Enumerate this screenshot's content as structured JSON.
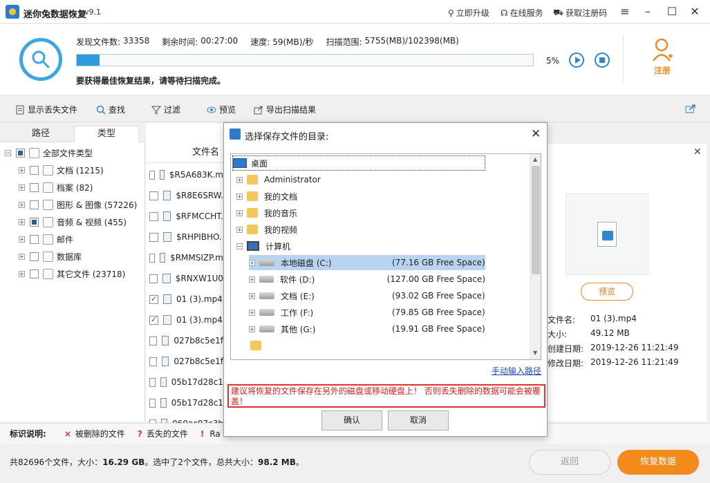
{
  "app": {
    "title": "迷你兔数据恢复",
    "version": "v9.1",
    "links": {
      "upgrade": "立即升级",
      "service": "在线服务",
      "get_code": "获取注册码"
    }
  },
  "scan": {
    "found_label": "发现文件数:",
    "found_value": "33358",
    "remaining_label": "剩余时间:",
    "remaining_value": "00:27:00",
    "speed_label": "速度:",
    "speed_value": "59(MB)/秒",
    "range_label": "扫描范围:",
    "range_value": "5755(MB)/102398(MB)",
    "progress_pct": 5,
    "progress_text": "5%",
    "note": "要获得最佳恢复结果，请等待扫描完成。",
    "register_label": "注册"
  },
  "toolbar": {
    "show_lost": "显示丢失文件",
    "find": "查找",
    "filter": "过滤",
    "preview": "预览",
    "export": "导出扫描结果"
  },
  "left": {
    "tabs": [
      "路径",
      "类型"
    ],
    "root": "全部文件类型",
    "items": [
      {
        "label": "文档 (1215)",
        "icon": "document-icon",
        "state": ""
      },
      {
        "label": "档案 (82)",
        "icon": "archive-icon",
        "state": ""
      },
      {
        "label": "图形 & 图像 (57226)",
        "icon": "image-icon",
        "state": ""
      },
      {
        "label": "音频 & 视频 (455)",
        "icon": "media-icon",
        "state": "partial"
      },
      {
        "label": "邮件",
        "icon": "mail-icon",
        "state": ""
      },
      {
        "label": "数据库",
        "icon": "database-icon",
        "state": ""
      },
      {
        "label": "其它文件 (23718)",
        "icon": "folder-icon",
        "state": ""
      }
    ]
  },
  "filelist": {
    "header": "文件名",
    "rows": [
      {
        "name": "$R5A683K.m",
        "checked": false
      },
      {
        "name": "$R8E6SRW.",
        "checked": false
      },
      {
        "name": "$RFMCCHT.",
        "checked": false
      },
      {
        "name": "$RHPIBHO.",
        "checked": false
      },
      {
        "name": "$RMMSIZP.m",
        "checked": false
      },
      {
        "name": "$RNXW1U0",
        "checked": false
      },
      {
        "name": "01 (3).mp4",
        "checked": true
      },
      {
        "name": "01 (3).mp4",
        "checked": true
      },
      {
        "name": "027b8c5e1f",
        "checked": false
      },
      {
        "name": "027b8c5e1f",
        "checked": false
      },
      {
        "name": "05b17d28c1",
        "checked": false
      },
      {
        "name": "05b17d28c1",
        "checked": false
      },
      {
        "name": "060ac07c3b",
        "checked": false
      }
    ]
  },
  "preview": {
    "button": "预览",
    "info": [
      {
        "k": "文件名:",
        "v": "01 (3).mp4"
      },
      {
        "k": "大小:",
        "v": "49.12 MB"
      },
      {
        "k": "创建日期:",
        "v": "2019-12-26 11:21:49"
      },
      {
        "k": "修改日期:",
        "v": "2019-12-26 11:21:49"
      }
    ]
  },
  "legend": {
    "title": "标识说明:",
    "deleted": "被删除的文件",
    "lost": "丢失的文件",
    "raw": "Ra"
  },
  "status": {
    "text_a": "共82696个文件，大小：",
    "size": "16.29 GB",
    "text_b": "。选中了2个文件，总共大小：",
    "sel_size": "98.2 MB",
    "text_c": "。",
    "back": "返回",
    "recover": "恢复数据"
  },
  "dialog": {
    "title": "选择保存文件的目录:",
    "desktop": "桌面",
    "nodes": [
      "Administrator",
      "我的文档",
      "我的音乐",
      "我的视频"
    ],
    "computer": "计算机",
    "drives": [
      {
        "name": "本地磁盘 (C:)",
        "space": "(77.16 GB Free Space)"
      },
      {
        "name": "软件 (D:)",
        "space": "(127.00 GB Free Space)"
      },
      {
        "name": "文档 (E:)",
        "space": "(93.02 GB Free Space)"
      },
      {
        "name": "工作 (F:)",
        "space": "(79.85 GB Free Space)"
      },
      {
        "name": "其他 (G:)",
        "space": "(19.91 GB Free Space)"
      }
    ],
    "manual": "手动输入路径",
    "warning": "建议将恢复的文件保存在另外的磁盘或移动硬盘上！ 否则丢失删除的数据可能会被覆盖！",
    "ok": "确认",
    "cancel": "取消"
  },
  "colors": {
    "accent": "#f58a1c",
    "blue": "#2d9be0",
    "warn": "#e03030"
  }
}
